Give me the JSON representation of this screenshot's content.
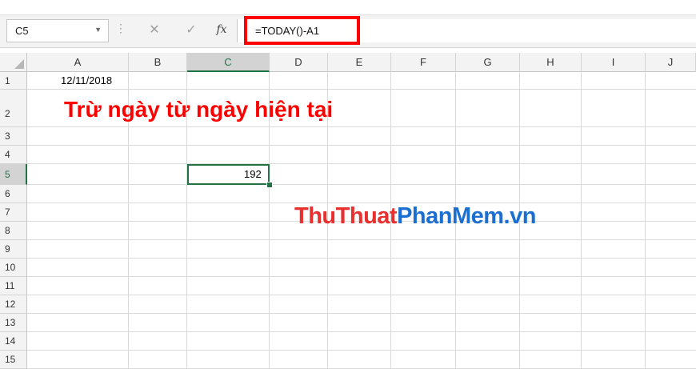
{
  "formula_bar": {
    "name_box": "C5",
    "cancel_icon": "close-icon",
    "enter_icon": "check-icon",
    "fx_label": "fx",
    "formula": "=TODAY()-A1"
  },
  "columns": [
    "A",
    "B",
    "C",
    "D",
    "E",
    "F",
    "G",
    "H",
    "I",
    "J"
  ],
  "selected_column": "C",
  "rows": [
    "1",
    "2",
    "3",
    "4",
    "5",
    "6",
    "7",
    "8",
    "9",
    "10",
    "11",
    "12",
    "13",
    "14",
    "15"
  ],
  "selected_row": "5",
  "cells": {
    "A1": "12/11/2018",
    "C5": "192"
  },
  "title": "Trừ ngày từ ngày hiện tại",
  "watermark": {
    "part1": "ThuThuat",
    "part2": "PhanMem.vn"
  },
  "colors": {
    "accent": "#217346",
    "highlight": "#ff0000",
    "title": "#ff0000",
    "watermark_red": "#e8312f",
    "watermark_blue": "#1a6fd1"
  }
}
